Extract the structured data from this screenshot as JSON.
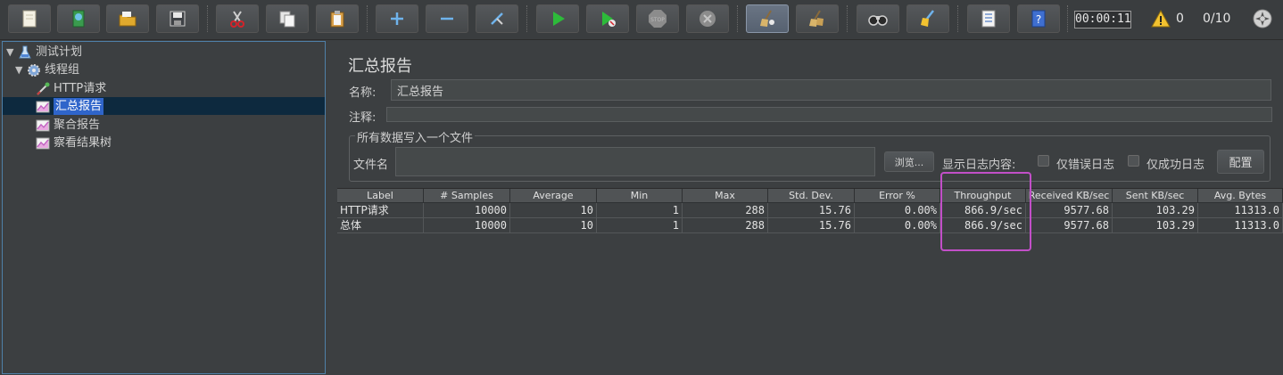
{
  "toolbar": {
    "buttons": [
      {
        "name": "new-plan-button",
        "icon": "new-document-icon"
      },
      {
        "name": "templates-button",
        "icon": "templates-icon"
      },
      {
        "name": "open-button",
        "icon": "open-folder-icon"
      },
      {
        "name": "save-button",
        "icon": "save-icon"
      },
      {
        "name": "cut-button",
        "icon": "cut-icon"
      },
      {
        "name": "copy-button",
        "icon": "copy-icon"
      },
      {
        "name": "paste-button",
        "icon": "paste-icon"
      },
      {
        "name": "expand-all-button",
        "icon": "plus-icon"
      },
      {
        "name": "collapse-all-button",
        "icon": "minus-icon"
      },
      {
        "name": "toggle-button",
        "icon": "toggle-icon"
      },
      {
        "name": "start-button",
        "icon": "play-icon"
      },
      {
        "name": "start-no-pause-button",
        "icon": "play-no-timer-icon"
      },
      {
        "name": "stop-button",
        "icon": "stop-icon"
      },
      {
        "name": "shutdown-button",
        "icon": "shutdown-icon"
      },
      {
        "name": "clear-button",
        "icon": "clear-broom-icon"
      },
      {
        "name": "clear-all-button",
        "icon": "clear-all-broom-icon"
      },
      {
        "name": "search-button",
        "icon": "binoculars-icon"
      },
      {
        "name": "reset-search-button",
        "icon": "reset-broom-icon"
      },
      {
        "name": "function-helper-button",
        "icon": "list-icon"
      },
      {
        "name": "help-button",
        "icon": "help-book-icon"
      }
    ],
    "timer": "00:00:11",
    "warning_count": "0",
    "threads": "0/10"
  },
  "tree": {
    "items": [
      {
        "label": "测试计划",
        "icon": "flask-icon",
        "level": 0,
        "expanded": true
      },
      {
        "label": "线程组",
        "icon": "gear-icon",
        "level": 1,
        "expanded": true
      },
      {
        "label": "HTTP请求",
        "icon": "pipette-icon",
        "level": 2
      },
      {
        "label": "汇总报告",
        "icon": "graph-icon",
        "level": 2,
        "selected": true
      },
      {
        "label": "聚合报告",
        "icon": "graph-icon",
        "level": 2
      },
      {
        "label": "察看结果树",
        "icon": "graph-icon",
        "level": 2
      }
    ]
  },
  "panel": {
    "title": "汇总报告",
    "name_label": "名称:",
    "name_value": "汇总报告",
    "comment_label": "注释:",
    "comment_value": "",
    "file_group_title": "所有数据写入一个文件",
    "filename_label": "文件名",
    "filename_value": "",
    "browse_label": "浏览...",
    "log_label": "显示日志内容:",
    "errors_only_label": "仅错误日志",
    "success_only_label": "仅成功日志",
    "configure_label": "配置"
  },
  "table": {
    "columns": [
      "Label",
      "# Samples",
      "Average",
      "Min",
      "Max",
      "Std. Dev.",
      "Error %",
      "Throughput",
      "Received KB/sec",
      "Sent KB/sec",
      "Avg. Bytes"
    ],
    "rows": [
      [
        "HTTP请求",
        "10000",
        "10",
        "1",
        "288",
        "15.76",
        "0.00%",
        "866.9/sec",
        "9577.68",
        "103.29",
        "11313.0"
      ],
      [
        "总体",
        "10000",
        "10",
        "1",
        "288",
        "15.76",
        "0.00%",
        "866.9/sec",
        "9577.68",
        "103.29",
        "11313.0"
      ]
    ]
  },
  "colors": {
    "highlight": "#c24fc8",
    "selection": "#2f65ca"
  }
}
